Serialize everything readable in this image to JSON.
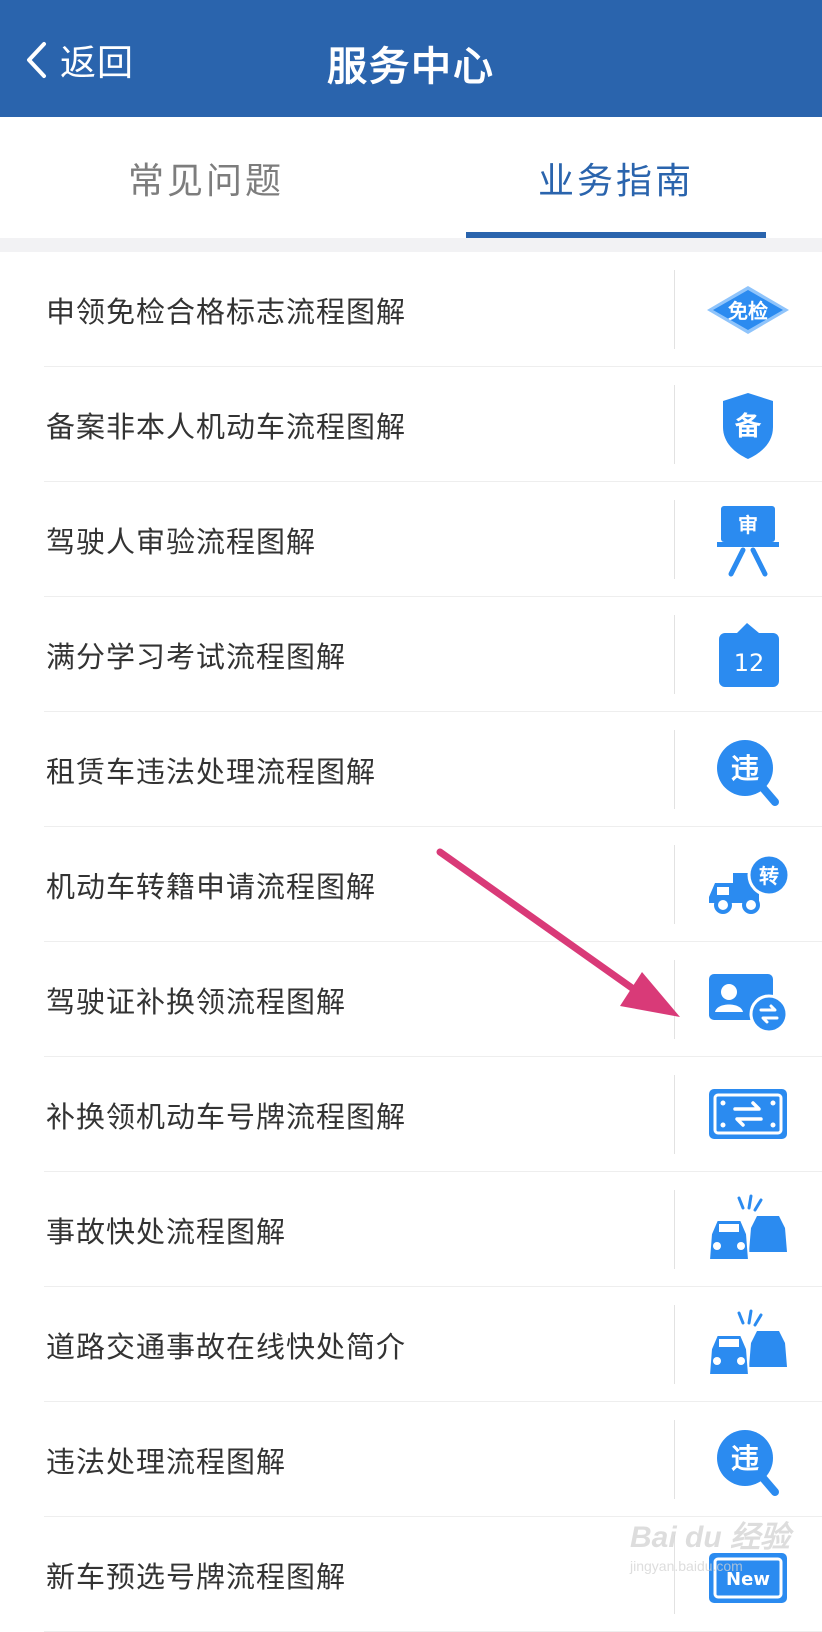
{
  "navbar": {
    "back_label": "返回",
    "title": "服务中心"
  },
  "tabs": [
    {
      "label": "常见问题",
      "active": false
    },
    {
      "label": "业务指南",
      "active": true
    }
  ],
  "colors": {
    "brand": "#2a64ad",
    "icon_blue": "#2b8bf0",
    "arrow": "#d93a78"
  },
  "items": [
    {
      "label": "申领免检合格标志流程图解",
      "icon": "exempt-inspection-diamond-icon",
      "icon_text": "免检"
    },
    {
      "label": "备案非本人机动车流程图解",
      "icon": "record-shield-icon",
      "icon_text": "备"
    },
    {
      "label": "驾驶人审验流程图解",
      "icon": "review-board-icon",
      "icon_text": "审"
    },
    {
      "label": "满分学习考试流程图解",
      "icon": "exam-calendar-icon",
      "icon_text": "12"
    },
    {
      "label": "租赁车违法处理流程图解",
      "icon": "violation-search-icon",
      "icon_text": "违"
    },
    {
      "label": "机动车转籍申请流程图解",
      "icon": "truck-transfer-icon",
      "icon_text": "转"
    },
    {
      "label": "驾驶证补换领流程图解",
      "icon": "license-swap-icon",
      "icon_text": ""
    },
    {
      "label": "补换领机动车号牌流程图解",
      "icon": "plate-swap-icon",
      "icon_text": ""
    },
    {
      "label": "事故快处流程图解",
      "icon": "car-collision-icon",
      "icon_text": ""
    },
    {
      "label": "道路交通事故在线快处简介",
      "icon": "car-collision-icon",
      "icon_text": ""
    },
    {
      "label": "违法处理流程图解",
      "icon": "violation-search-icon",
      "icon_text": "违"
    },
    {
      "label": "新车预选号牌流程图解",
      "icon": "new-plate-icon",
      "icon_text": "New"
    }
  ],
  "watermark": {
    "brand": "Bai du 经验",
    "sub": "jingyan.baidu.com"
  }
}
